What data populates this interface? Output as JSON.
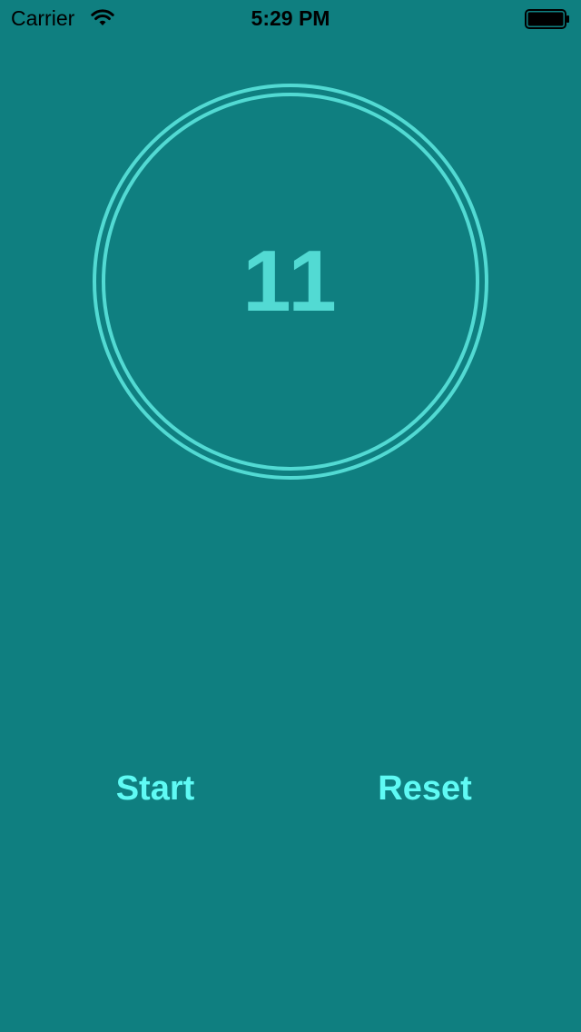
{
  "status_bar": {
    "carrier": "Carrier",
    "time": "5:29 PM",
    "icons": [
      "wifi-icon",
      "battery-icon"
    ]
  },
  "timer": {
    "value": "11",
    "ring_color": "#52dad3"
  },
  "controls": {
    "start_label": "Start",
    "reset_label": "Reset",
    "button_color": "#5ffaf4"
  },
  "colors": {
    "background": "#0f7f80"
  }
}
